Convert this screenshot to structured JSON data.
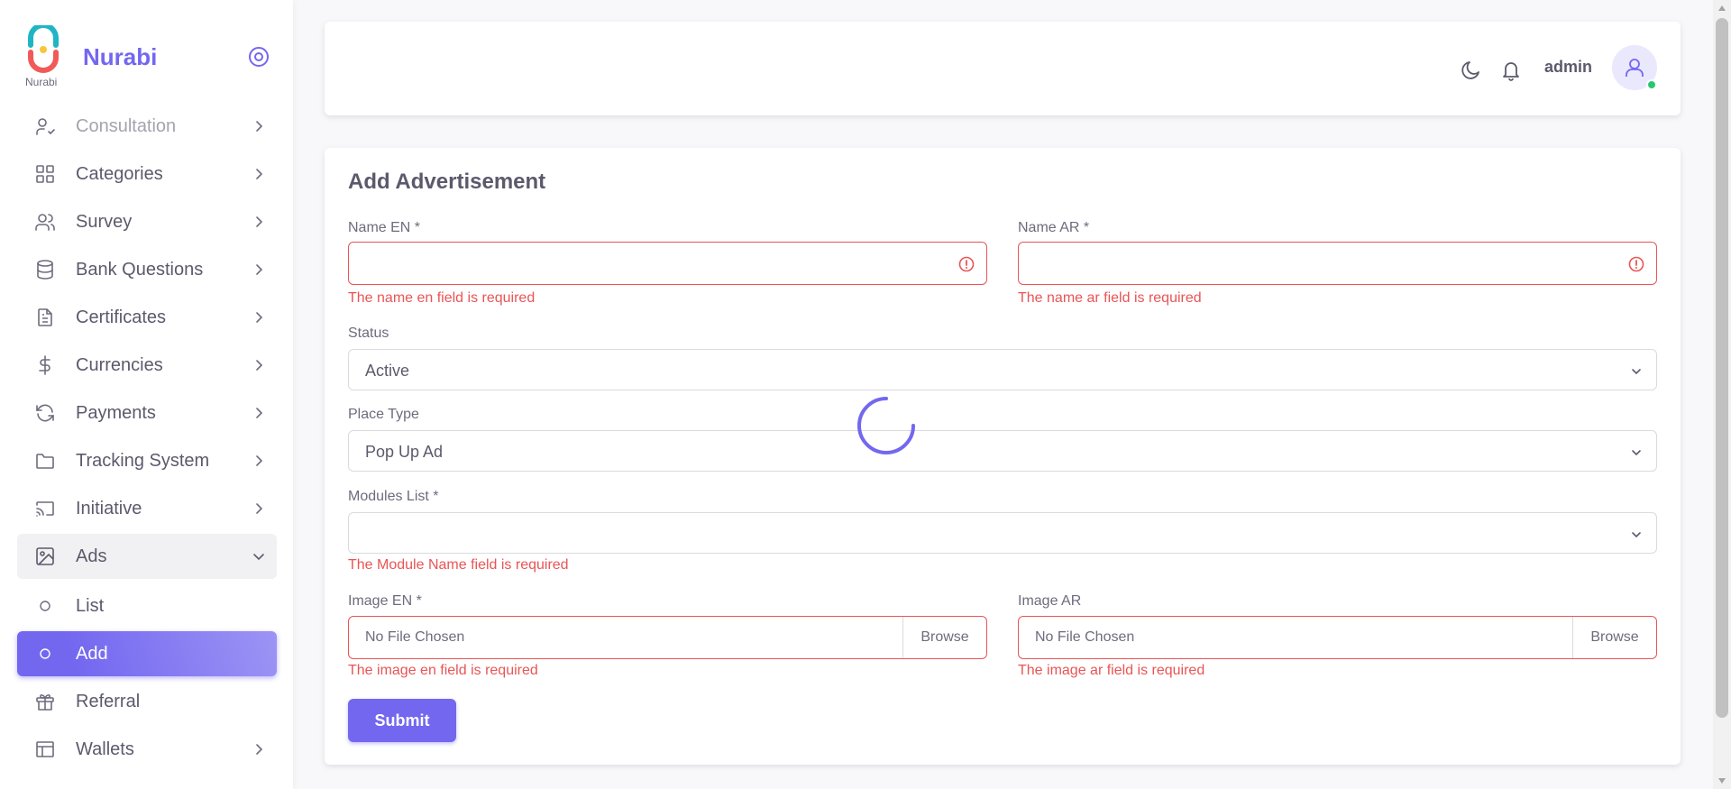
{
  "brand": {
    "name": "Nurabi",
    "logo_text": "Nurabi"
  },
  "sidebar": {
    "items": [
      {
        "label": "Consultation",
        "icon": "user-check-icon",
        "chevron": "right"
      },
      {
        "label": "Categories",
        "icon": "grid-icon",
        "chevron": "right"
      },
      {
        "label": "Survey",
        "icon": "users-icon",
        "chevron": "right"
      },
      {
        "label": "Bank Questions",
        "icon": "database-icon",
        "chevron": "right"
      },
      {
        "label": "Certificates",
        "icon": "file-text-icon",
        "chevron": "right"
      },
      {
        "label": "Currencies",
        "icon": "dollar-icon",
        "chevron": "right"
      },
      {
        "label": "Payments",
        "icon": "refresh-icon",
        "chevron": "right"
      },
      {
        "label": "Tracking System",
        "icon": "folder-icon",
        "chevron": "right"
      },
      {
        "label": "Initiative",
        "icon": "cast-icon",
        "chevron": "right"
      },
      {
        "label": "Ads",
        "icon": "image-icon",
        "chevron": "down"
      },
      {
        "label": "List",
        "icon": "circle-icon"
      },
      {
        "label": "Add",
        "icon": "circle-icon"
      },
      {
        "label": "Referral",
        "icon": "gift-icon"
      },
      {
        "label": "Wallets",
        "icon": "wallet-icon",
        "chevron": "right"
      }
    ]
  },
  "navbar": {
    "username": "admin"
  },
  "form": {
    "title": "Add Advertisement",
    "name_en": {
      "label": "Name EN *",
      "value": "",
      "error": "The name en field is required"
    },
    "name_ar": {
      "label": "Name AR *",
      "value": "",
      "error": "The name ar field is required"
    },
    "status": {
      "label": "Status",
      "value": "Active"
    },
    "place_type": {
      "label": "Place Type",
      "value": "Pop Up Ad"
    },
    "modules": {
      "label": "Modules List *",
      "value": "",
      "error": "The Module Name field is required"
    },
    "image_en": {
      "label": "Image EN *",
      "file_text": "No File Chosen",
      "browse": "Browse",
      "error": "The image en field is required"
    },
    "image_ar": {
      "label": "Image AR",
      "file_text": "No File Chosen",
      "browse": "Browse",
      "error": "The image ar field is required"
    },
    "submit": "Submit"
  },
  "colors": {
    "primary": "#7367f0",
    "error": "#ea5455",
    "online": "#28c76f"
  }
}
